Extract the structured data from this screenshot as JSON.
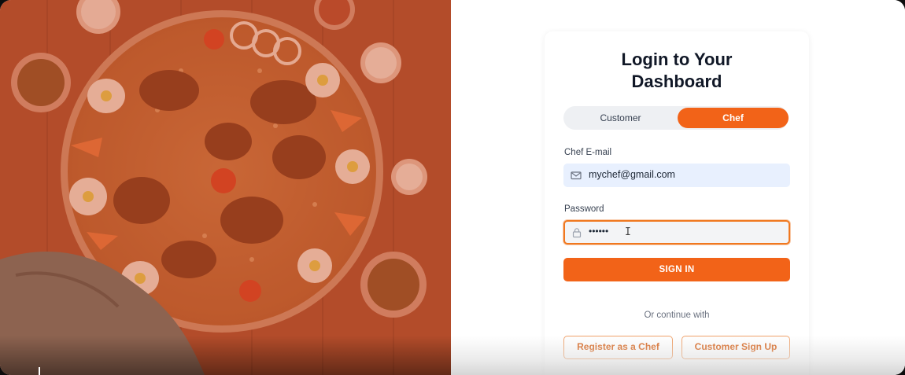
{
  "login": {
    "title": "Login to Your\nDashboard",
    "tabs": {
      "customer": "Customer",
      "chef": "Chef",
      "active": "Chef"
    },
    "email": {
      "label": "Chef E-mail",
      "value": "mychef@gmail.com",
      "icon": "mail-icon"
    },
    "password": {
      "label": "Password",
      "value": "••••••",
      "icon": "lock-icon"
    },
    "signin_label": "SIGN IN",
    "divider_text": "Or continue with",
    "register_chef_label": "Register as a Chef",
    "customer_signup_label": "Customer Sign Up"
  },
  "colors": {
    "accent": "#f26318",
    "hero_tint": "#c8552a",
    "email_bg": "#e8f0fe"
  },
  "hero": {
    "image": "biryani-platter-photo"
  }
}
